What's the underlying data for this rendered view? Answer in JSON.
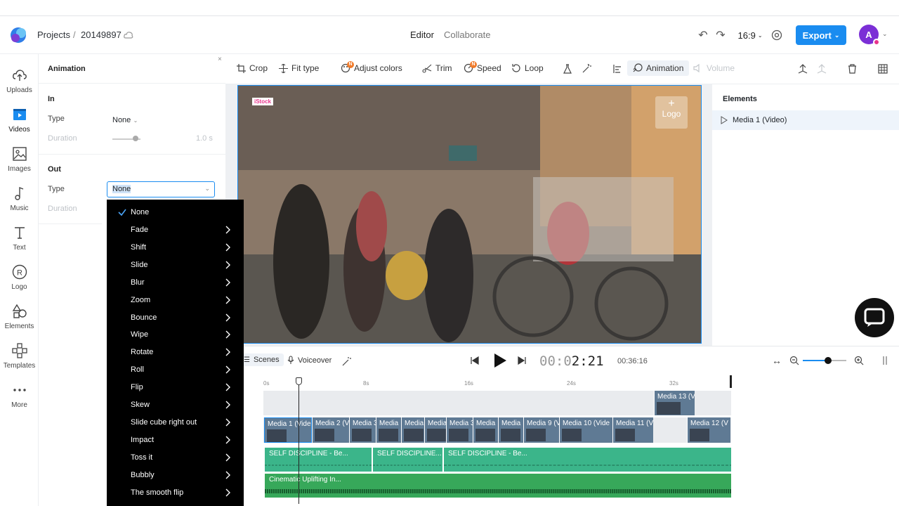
{
  "header": {
    "breadcrumb_projects": "Projects",
    "breadcrumb_sep": "/",
    "project_id": "20149897",
    "tab_editor": "Editor",
    "tab_collaborate": "Collaborate",
    "aspect_ratio": "16:9",
    "export_label": "Export",
    "avatar_letter": "A"
  },
  "sidebar": {
    "items": [
      {
        "label": "Uploads",
        "icon": "upload-icon"
      },
      {
        "label": "Videos",
        "icon": "video-icon"
      },
      {
        "label": "Images",
        "icon": "image-icon"
      },
      {
        "label": "Music",
        "icon": "music-icon"
      },
      {
        "label": "Text",
        "icon": "text-icon"
      },
      {
        "label": "Logo",
        "icon": "logo-icon"
      },
      {
        "label": "Elements",
        "icon": "elements-icon"
      },
      {
        "label": "Templates",
        "icon": "templates-icon"
      },
      {
        "label": "More",
        "icon": "more-icon"
      }
    ]
  },
  "animation_panel": {
    "title": "Animation",
    "close": "×",
    "in_label": "In",
    "type_label": "Type",
    "in_type_value": "None",
    "duration_label": "Duration",
    "duration_value": "1.0 s",
    "out_label": "Out",
    "out_type_value": "None"
  },
  "dropdown": {
    "selected": "None",
    "items": [
      "Fade",
      "Shift",
      "Slide",
      "Blur",
      "Zoom",
      "Bounce",
      "Wipe",
      "Rotate",
      "Roll",
      "Flip",
      "Skew",
      "Slide cube right out",
      "Impact",
      "Toss it",
      "Bubbly",
      "The smooth flip"
    ]
  },
  "toolbar": {
    "crop": "Crop",
    "fit_type": "Fit type",
    "adjust_colors": "Adjust colors",
    "trim": "Trim",
    "speed": "Speed",
    "loop": "Loop",
    "animation": "Animation",
    "volume": "Volume",
    "new_badge": "N"
  },
  "video": {
    "stock_tag": "iStock",
    "logo_plus": "+",
    "logo_label": "Logo"
  },
  "elements_panel": {
    "title": "Elements",
    "item": "Media 1 (Video)"
  },
  "timeline": {
    "scenes": "Scenes",
    "voiceover": "Voiceover",
    "time_dim": "00:0",
    "time_bright": "2:21",
    "total_time": "00:36:16",
    "ruler": [
      "0s",
      "8s",
      "16s",
      "24s",
      "32s"
    ],
    "overlay_clip": "Media 13 (V",
    "clips": [
      "Media 1 (Vide",
      "Media 2 (V",
      "Media 3",
      "Media",
      "Media",
      "Media",
      "Media 3",
      "Media",
      "Media",
      "Media 9 (V",
      "Media 10 (Vide",
      "Media 11 (V",
      "Media 12 (V"
    ],
    "audio_1": [
      "SELF DISCIPLINE - Be...",
      "SELF DISCIPLINE...",
      "SELF DISCIPLINE - Be..."
    ],
    "audio_2": "Cinematic Uplifting In..."
  },
  "colors": {
    "accent": "#1a8cf0",
    "audio_green": "#3bb58a",
    "clip_blue": "#5f7a94"
  }
}
